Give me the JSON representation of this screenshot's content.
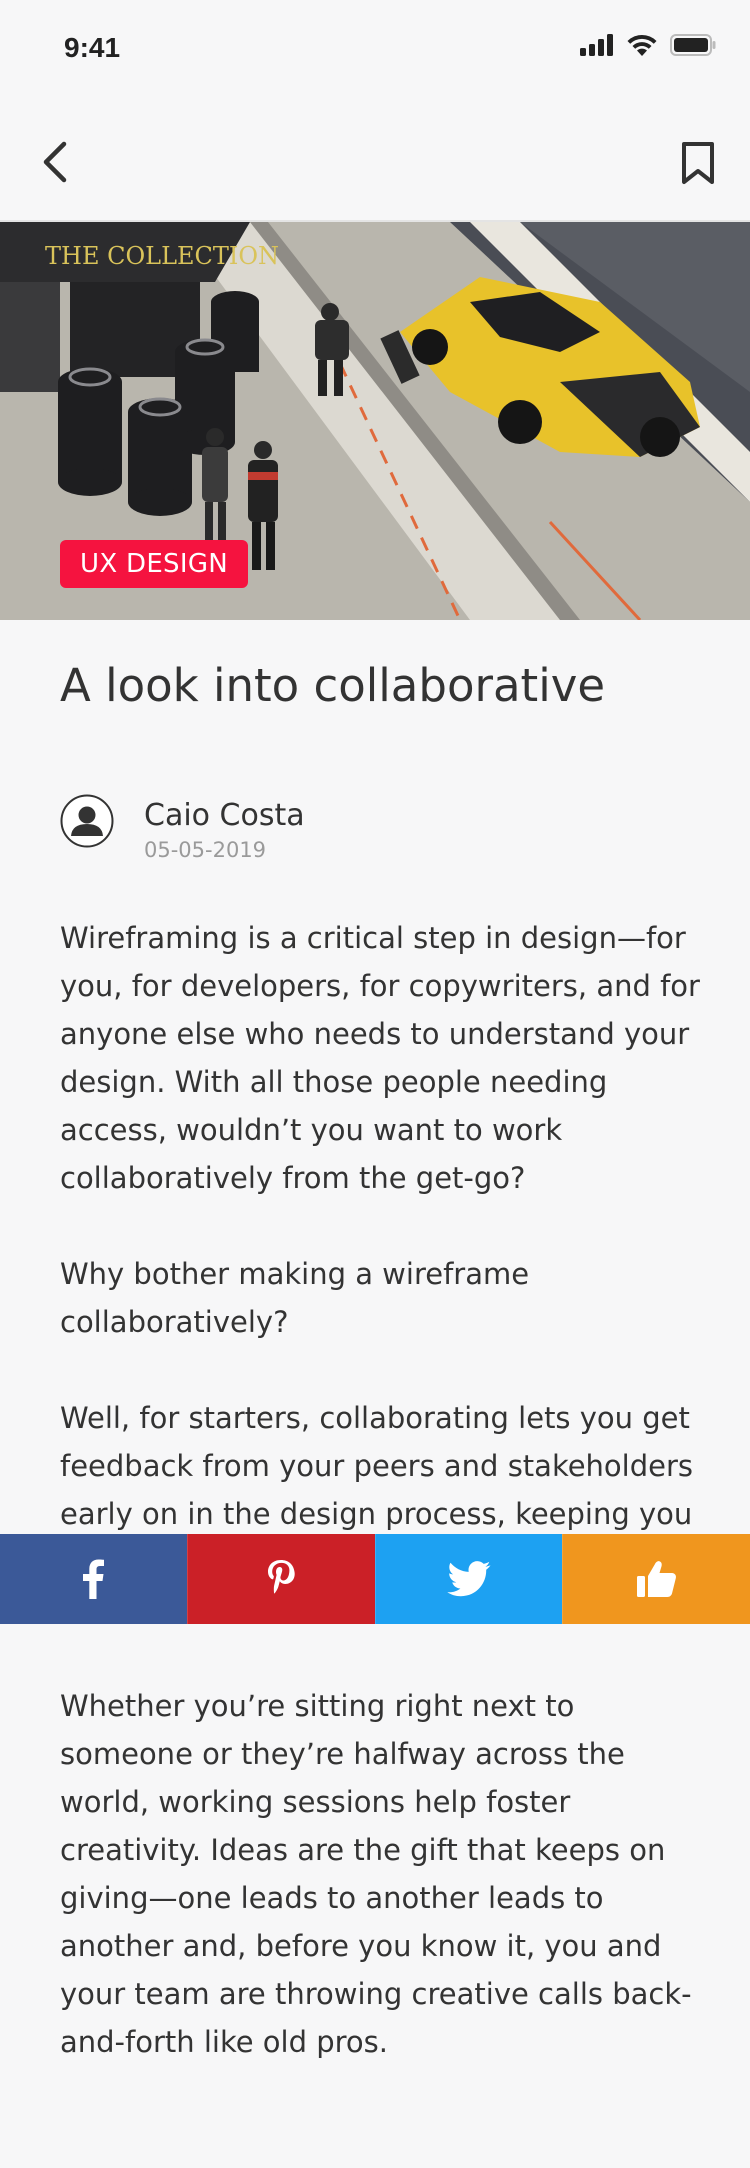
{
  "status_bar": {
    "time": "9:41",
    "icons": [
      "signal-icon",
      "wifi-icon",
      "battery-icon"
    ]
  },
  "nav": {
    "back_icon": "chevron-left-icon",
    "bookmark_icon": "bookmark-icon"
  },
  "hero": {
    "tag": "UX DESIGN",
    "banner_text": "THE COLLECTION"
  },
  "article": {
    "title": "A look into collaborative",
    "author": {
      "name": "Caio Costa",
      "date": "05-05-2019"
    },
    "paragraphs": [
      "Wireframing is a critical step in design—for you, for developers, for copywriters, and for anyone else who needs to understand your design. With all those people needing access, wouldn’t you want to work collaboratively from the get-go?",
      "Why bother making a wireframe collaboratively?",
      "Well, for starters, collaborating lets you get feedback from your peers and stakeholders early on in the design process, keeping you",
      "Whether you’re sitting right next to someone or they’re halfway across the world, working sessions help foster creativity. Ideas are the gift that keeps on giving—one leads to another leads to another and, before you know it, you and your team are throwing creative calls back-and-forth like old pros."
    ]
  },
  "share_bar": {
    "buttons": [
      {
        "name": "facebook",
        "icon": "facebook-icon",
        "color": "#3b5998"
      },
      {
        "name": "pinterest",
        "icon": "pinterest-icon",
        "color": "#cb2027"
      },
      {
        "name": "twitter",
        "icon": "twitter-icon",
        "color": "#1da1f2"
      },
      {
        "name": "like",
        "icon": "thumbs-up-icon",
        "color": "#f0961e"
      }
    ]
  },
  "colors": {
    "tag_bg": "#f5133f",
    "background": "#f7f7f8",
    "text": "#333333",
    "muted": "#9a9a9a"
  }
}
